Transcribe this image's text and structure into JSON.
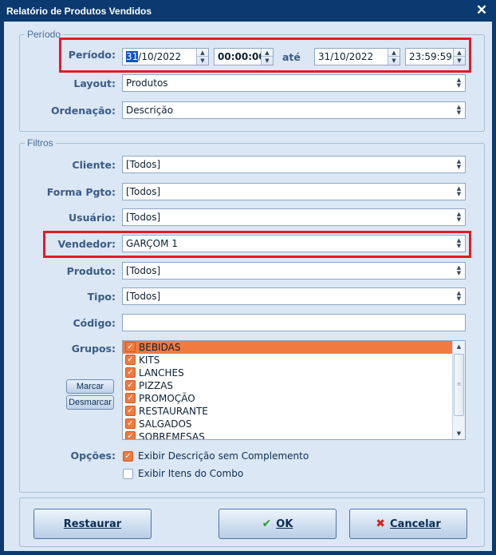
{
  "window": {
    "title": "Relatório de Produtos Vendidos",
    "close_glyph": "✕"
  },
  "periodo": {
    "legend": "Período",
    "periodo_label": "Período:",
    "date_from_sel": "31",
    "date_from_rest": "/10/2022",
    "time_from": "00:00:00",
    "ate_label": "até",
    "date_to": "31/10/2022",
    "time_to": "23:59:59",
    "layout_label": "Layout:",
    "layout_value": "Produtos",
    "ordenacao_label": "Ordenação:",
    "ordenacao_value": "Descrição"
  },
  "filtros": {
    "legend": "Filtros",
    "cliente_label": "Cliente:",
    "cliente_value": "[Todos]",
    "forma_label": "Forma Pgto:",
    "forma_value": "[Todos]",
    "usuario_label": "Usuário:",
    "usuario_value": "[Todos]",
    "vendedor_label": "Vendedor:",
    "vendedor_value": "GARÇOM 1",
    "produto_label": "Produto:",
    "produto_value": "[Todos]",
    "tipo_label": "Tipo:",
    "tipo_value": "[Todos]",
    "codigo_label": "Código:",
    "codigo_value": "",
    "grupos_label": "Grupos:",
    "grupos": [
      {
        "label": "BEBIDAS",
        "checked": true
      },
      {
        "label": "KITS",
        "checked": true
      },
      {
        "label": "LANCHES",
        "checked": true
      },
      {
        "label": "PIZZAS",
        "checked": true
      },
      {
        "label": "PROMOÇÃO",
        "checked": true
      },
      {
        "label": "RESTAURANTE",
        "checked": true
      },
      {
        "label": "SALGADOS",
        "checked": true
      },
      {
        "label": "SOBREMESAS",
        "checked": true
      }
    ],
    "marcar_label": "Marcar",
    "desmarcar_label": "Desmarcar",
    "opcoes_label": "Opções:",
    "opt1_label": "Exibir Descrição sem Complemento",
    "opt1_checked": true,
    "opt2_label": "Exibir Itens do Combo",
    "opt2_checked": false
  },
  "buttons": {
    "restaurar": "Restaurar",
    "ok": "OK",
    "cancelar": "Cancelar"
  },
  "colors": {
    "highlight_box": "#e31b23",
    "accent_orange": "#ee7b3f",
    "titlebar": "#0b3a70"
  }
}
